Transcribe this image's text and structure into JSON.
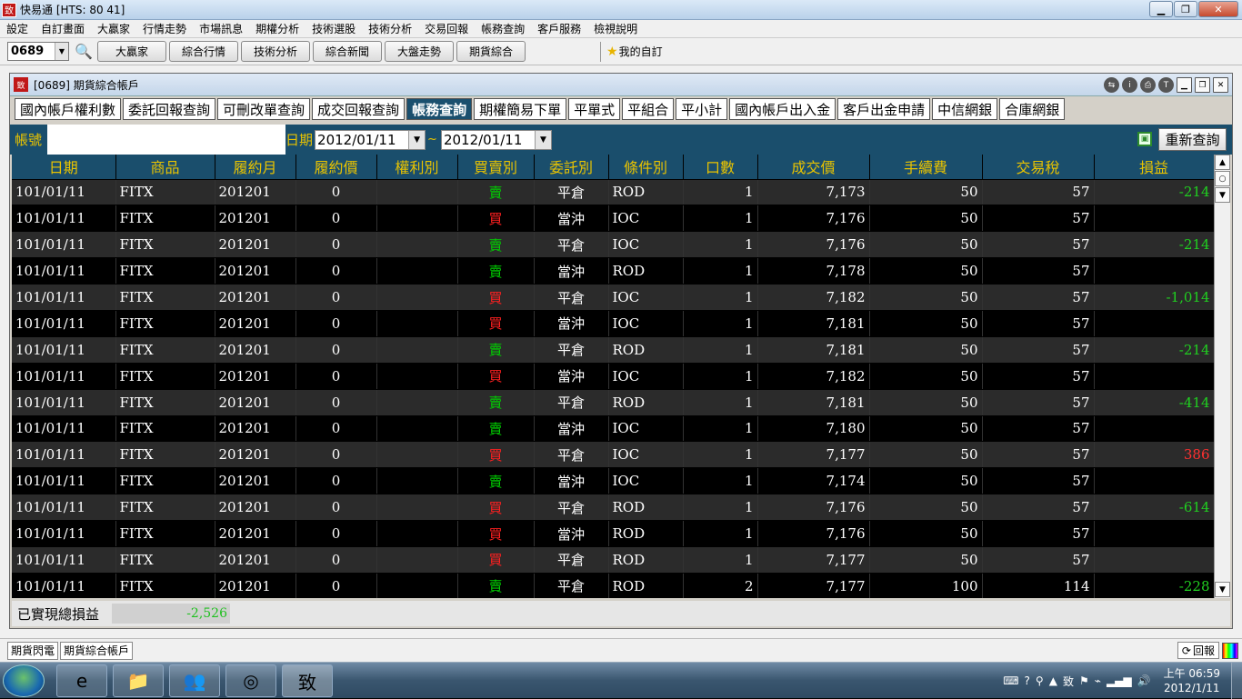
{
  "app": {
    "title": "快易通 [HTS: 80 41]",
    "logo": "致"
  },
  "menu": [
    "設定",
    "自訂畫面",
    "大贏家",
    "行情走勢",
    "市場訊息",
    "期權分析",
    "技術選股",
    "技術分析",
    "交易回報",
    "帳務查詢",
    "客戶服務",
    "檢視說明"
  ],
  "toolbar": {
    "stock_code": "0689",
    "buttons": [
      "大贏家",
      "綜合行情",
      "技術分析",
      "綜合新聞",
      "大盤走勢",
      "期貨綜合"
    ],
    "favorites": "我的自訂"
  },
  "child": {
    "title": "[0689] 期貨綜合帳戶"
  },
  "tabs": [
    "國內帳戶權利數",
    "委託回報查詢",
    "可刪改單查詢",
    "成交回報查詢",
    "帳務查詢",
    "期權簡易下單",
    "平單式",
    "平組合",
    "平小計",
    "國內帳戶出入金",
    "客戶出金申請",
    "中信網銀",
    "合庫網銀"
  ],
  "active_tab": "帳務查詢",
  "query": {
    "account_label": "帳號",
    "date_label": "日期",
    "date_from": "2012/01/11",
    "tilde": "~",
    "date_to": "2012/01/11",
    "requery_button": "重新查詢"
  },
  "columns": [
    "日期",
    "商品",
    "履約月",
    "履約價",
    "權利別",
    "買賣別",
    "委託別",
    "條件別",
    "口數",
    "成交價",
    "手續費",
    "交易稅",
    "損益"
  ],
  "rows": [
    [
      "101/01/11",
      "FITX",
      "201201",
      "0",
      "",
      "賣",
      "平倉",
      "ROD",
      "1",
      "7,173",
      "50",
      "57",
      "-214"
    ],
    [
      "101/01/11",
      "FITX",
      "201201",
      "0",
      "",
      "買",
      "當沖",
      "IOC",
      "1",
      "7,176",
      "50",
      "57",
      ""
    ],
    [
      "101/01/11",
      "FITX",
      "201201",
      "0",
      "",
      "賣",
      "平倉",
      "IOC",
      "1",
      "7,176",
      "50",
      "57",
      "-214"
    ],
    [
      "101/01/11",
      "FITX",
      "201201",
      "0",
      "",
      "賣",
      "當沖",
      "ROD",
      "1",
      "7,178",
      "50",
      "57",
      ""
    ],
    [
      "101/01/11",
      "FITX",
      "201201",
      "0",
      "",
      "買",
      "平倉",
      "IOC",
      "1",
      "7,182",
      "50",
      "57",
      "-1,014"
    ],
    [
      "101/01/11",
      "FITX",
      "201201",
      "0",
      "",
      "買",
      "當沖",
      "IOC",
      "1",
      "7,181",
      "50",
      "57",
      ""
    ],
    [
      "101/01/11",
      "FITX",
      "201201",
      "0",
      "",
      "賣",
      "平倉",
      "ROD",
      "1",
      "7,181",
      "50",
      "57",
      "-214"
    ],
    [
      "101/01/11",
      "FITX",
      "201201",
      "0",
      "",
      "買",
      "當沖",
      "IOC",
      "1",
      "7,182",
      "50",
      "57",
      ""
    ],
    [
      "101/01/11",
      "FITX",
      "201201",
      "0",
      "",
      "賣",
      "平倉",
      "ROD",
      "1",
      "7,181",
      "50",
      "57",
      "-414"
    ],
    [
      "101/01/11",
      "FITX",
      "201201",
      "0",
      "",
      "賣",
      "當沖",
      "IOC",
      "1",
      "7,180",
      "50",
      "57",
      ""
    ],
    [
      "101/01/11",
      "FITX",
      "201201",
      "0",
      "",
      "買",
      "平倉",
      "IOC",
      "1",
      "7,177",
      "50",
      "57",
      "386"
    ],
    [
      "101/01/11",
      "FITX",
      "201201",
      "0",
      "",
      "賣",
      "當沖",
      "IOC",
      "1",
      "7,174",
      "50",
      "57",
      ""
    ],
    [
      "101/01/11",
      "FITX",
      "201201",
      "0",
      "",
      "買",
      "平倉",
      "ROD",
      "1",
      "7,176",
      "50",
      "57",
      "-614"
    ],
    [
      "101/01/11",
      "FITX",
      "201201",
      "0",
      "",
      "買",
      "當沖",
      "ROD",
      "1",
      "7,176",
      "50",
      "57",
      ""
    ],
    [
      "101/01/11",
      "FITX",
      "201201",
      "0",
      "",
      "買",
      "平倉",
      "ROD",
      "1",
      "7,177",
      "50",
      "57",
      ""
    ],
    [
      "101/01/11",
      "FITX",
      "201201",
      "0",
      "",
      "賣",
      "平倉",
      "ROD",
      "2",
      "7,177",
      "100",
      "114",
      "-228"
    ]
  ],
  "summary": {
    "label": "已實現總損益",
    "value": "-2,526"
  },
  "statusbar": {
    "tabs": [
      "期貨閃電",
      "期貨綜合帳戶"
    ],
    "report_button": "回報"
  },
  "taskbar": {
    "time": "上午 06:59",
    "date": "2012/1/11"
  },
  "colors": {
    "header_bg": "#1a4e6c",
    "header_text": "#e9c300",
    "sell": "#00d000",
    "buy": "#ff2020",
    "loss": "#20d020",
    "profit": "#ff3030"
  }
}
